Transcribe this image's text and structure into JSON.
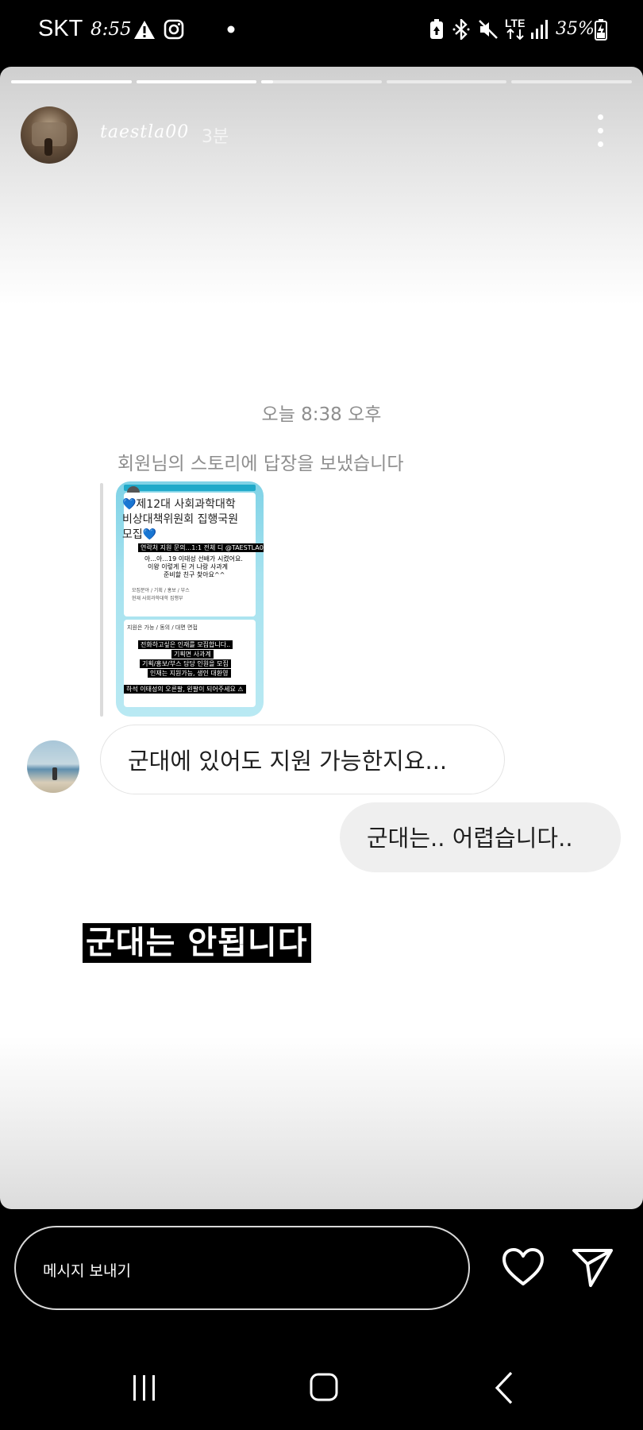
{
  "status_bar": {
    "carrier": "SKT",
    "time": "8:55",
    "network": "LTE",
    "battery": "35%"
  },
  "story": {
    "progress": [
      1,
      1,
      0.1,
      0,
      0
    ],
    "username": "taestla00",
    "posted_ago": "3분",
    "timestamp": "오늘 8:38 오후",
    "reply_note": "회원님의 스토리에 답장을 보냈습니다",
    "thumbnail": {
      "title": "💙제12대 사회과학대학 비상대책위원회 집행국원 모집💙",
      "lines": [
        "변상국 지원 문의 1:1 전체 디 @TAESTLA00",
        "아...아...19 이태성 선배가 시켰어요.",
        "이왕 이렇게 된 거 나랑 사과계",
        "준비할 친구 찾아요^^",
        "모집분야 / 기획 / 홍보 / 부스",
        "현재 사회과학대학 집행부",
        "지원은 가능 / 동의 / 대면 면접"
      ],
      "tag_lines": [
        "연락처 지원 문의...1:1 전체 디 @TAESTLA00",
        "전화하고싶은 인재를 모집합니다..",
        "기획면 사과계",
        "기획/홍보/부스 담당 인원을 모집",
        "인재는 지원가능, 생인 대환영",
        "하석 이태성의 오른팔, 왼팔이 되어주세요 ⚠"
      ]
    },
    "messages": [
      {
        "direction": "in",
        "text": "군대에 있어도 지원 가능한지요..."
      },
      {
        "direction": "out",
        "text": "군대는.. 어렵습니다.."
      }
    ],
    "caption": "군대는 안됩니다"
  },
  "composer": {
    "placeholder": "메시지 보내기"
  },
  "icons": {
    "story_more": "more-vertical-icon",
    "like": "heart-icon",
    "send": "send-icon",
    "nav_recent": "recent-apps-icon",
    "nav_home": "home-icon",
    "nav_back": "back-icon"
  },
  "colors": {
    "background": "#000000",
    "bubble_incoming": "#ffffff",
    "bubble_outgoing": "#efefef",
    "meta_text": "#8e8e8e"
  }
}
